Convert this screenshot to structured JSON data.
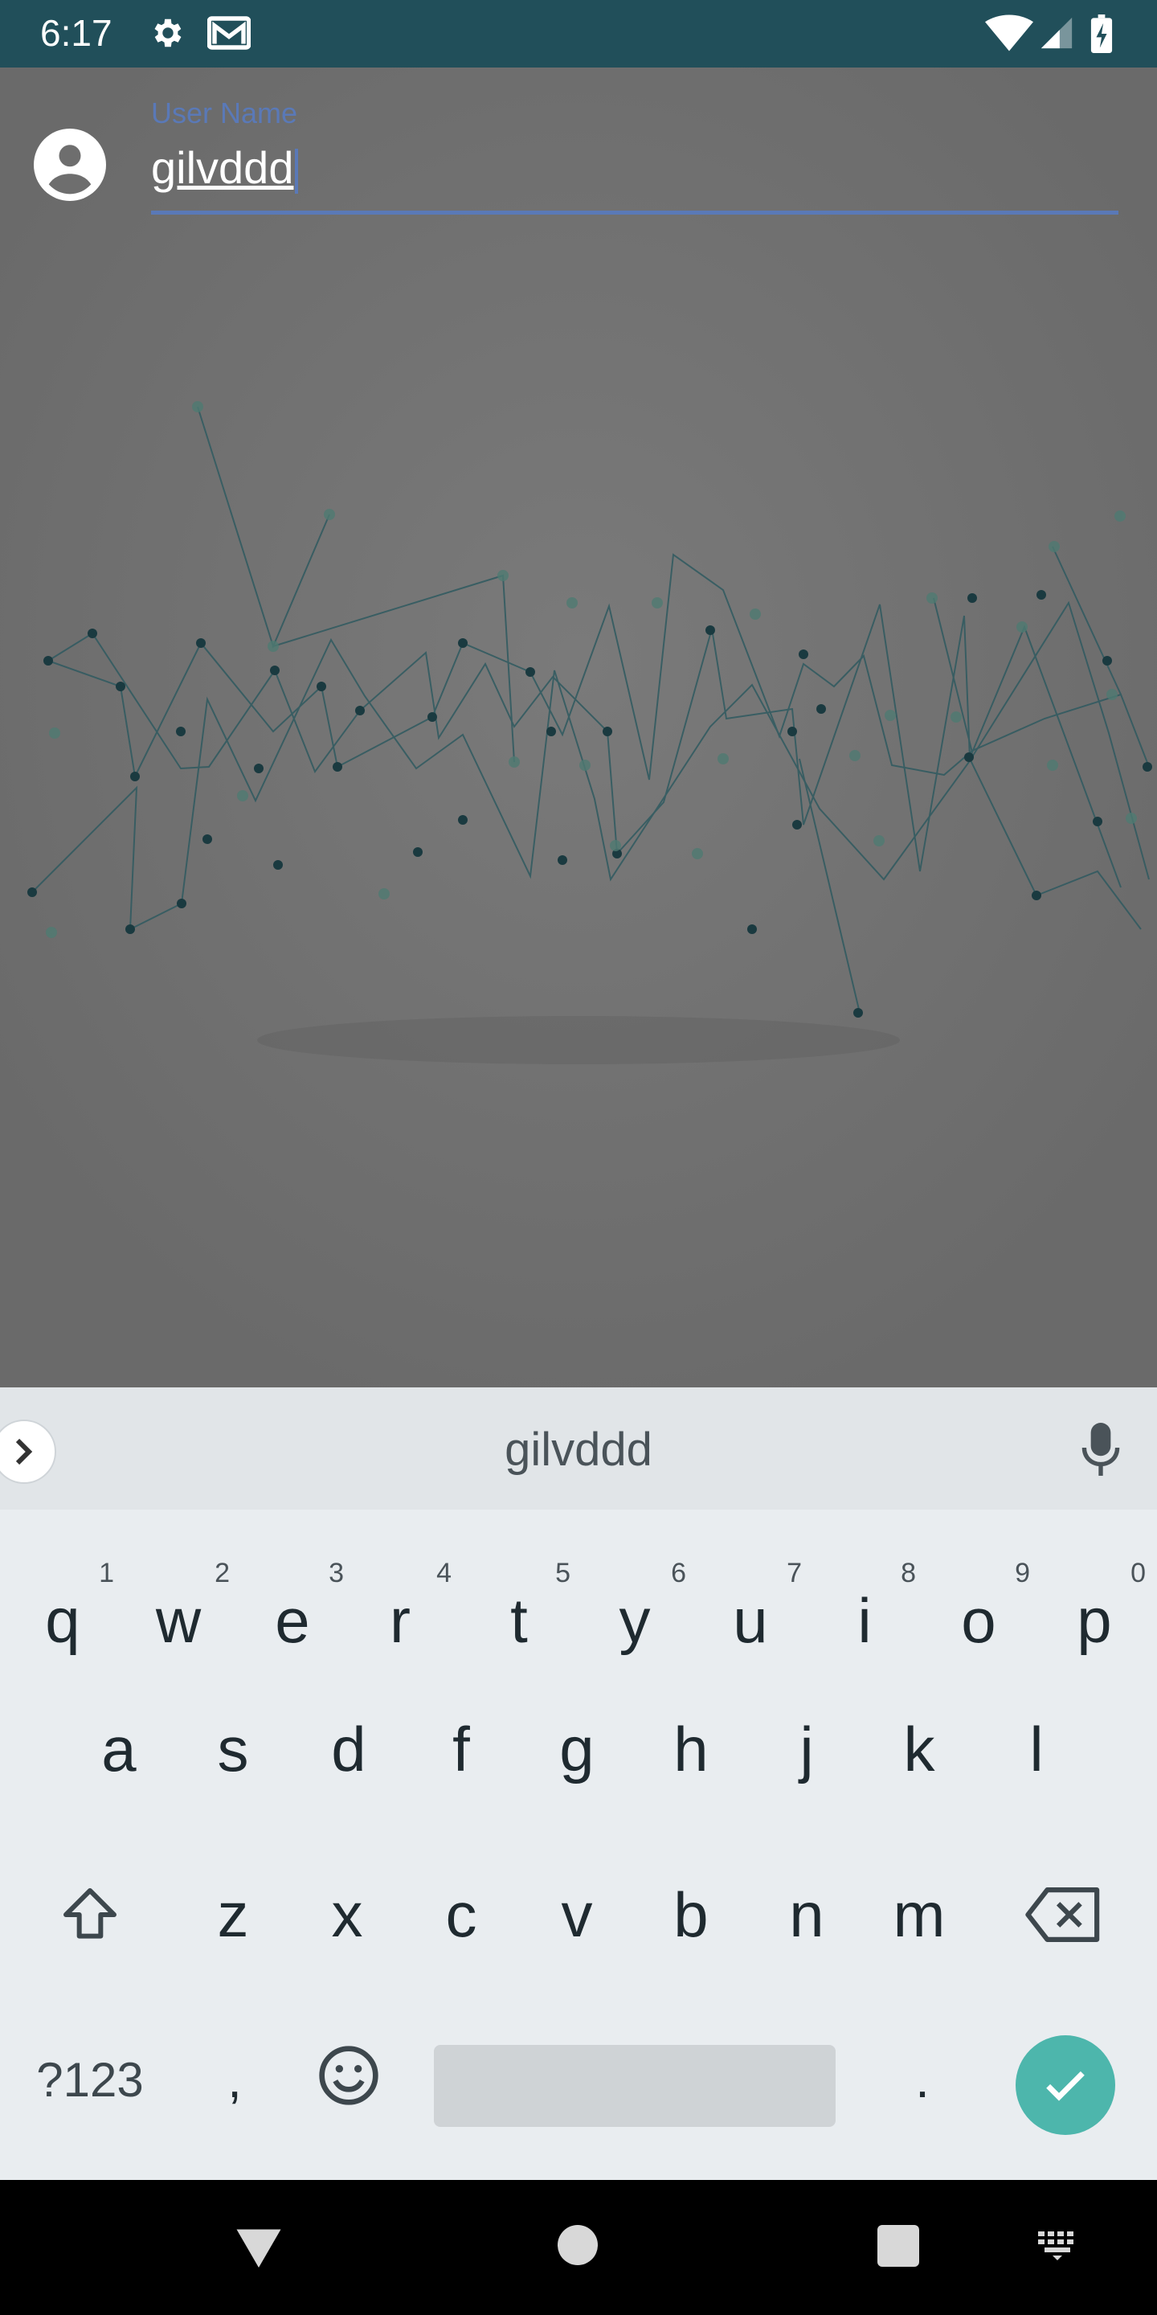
{
  "status_bar": {
    "time": "6:17",
    "icons": [
      "settings-icon",
      "gmail-icon",
      "wifi-icon",
      "signal-icon",
      "battery-charging-icon"
    ],
    "background": "#214f5a"
  },
  "form": {
    "username_label": "User Name",
    "username_value": "gilvddd",
    "accent": "#5a79b7"
  },
  "keyboard": {
    "suggestion": "gilvddd",
    "row1": [
      {
        "key": "q",
        "hint": "1"
      },
      {
        "key": "w",
        "hint": "2"
      },
      {
        "key": "e",
        "hint": "3"
      },
      {
        "key": "r",
        "hint": "4"
      },
      {
        "key": "t",
        "hint": "5"
      },
      {
        "key": "y",
        "hint": "6"
      },
      {
        "key": "u",
        "hint": "7"
      },
      {
        "key": "i",
        "hint": "8"
      },
      {
        "key": "o",
        "hint": "9"
      },
      {
        "key": "p",
        "hint": "0"
      }
    ],
    "row2": [
      "a",
      "s",
      "d",
      "f",
      "g",
      "h",
      "j",
      "k",
      "l"
    ],
    "row3": [
      "z",
      "x",
      "c",
      "v",
      "b",
      "n",
      "m"
    ],
    "symbols_label": "?123",
    "comma": ",",
    "period": ".",
    "enter_color": "#4db6ac"
  },
  "nav_bar": {
    "icons": [
      "back-icon",
      "home-icon",
      "recents-icon",
      "keyboard-switch-icon"
    ]
  }
}
